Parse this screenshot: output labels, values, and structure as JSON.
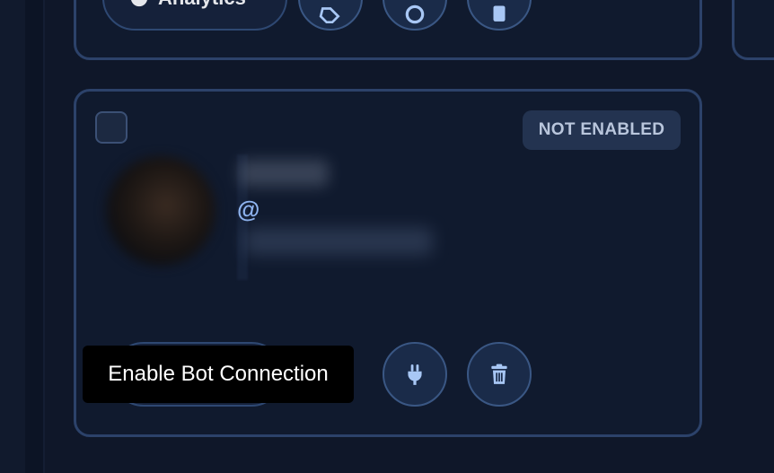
{
  "top_card": {
    "analytics_label": "Analytics",
    "icons": [
      "pie-chart-icon",
      "eraser-icon",
      "refresh-icon",
      "trash-icon"
    ]
  },
  "bot_card": {
    "status": "NOT ENABLED",
    "handle_prefix": "@",
    "tooltip": "Enable Bot Connection",
    "icons": [
      "plug-icon",
      "trash-icon"
    ]
  },
  "colors": {
    "background": "#0f1729",
    "card_border": "#2c426a",
    "icon": "#a8c7f5",
    "badge_bg": "#233350",
    "badge_text": "#b9c6dc"
  }
}
